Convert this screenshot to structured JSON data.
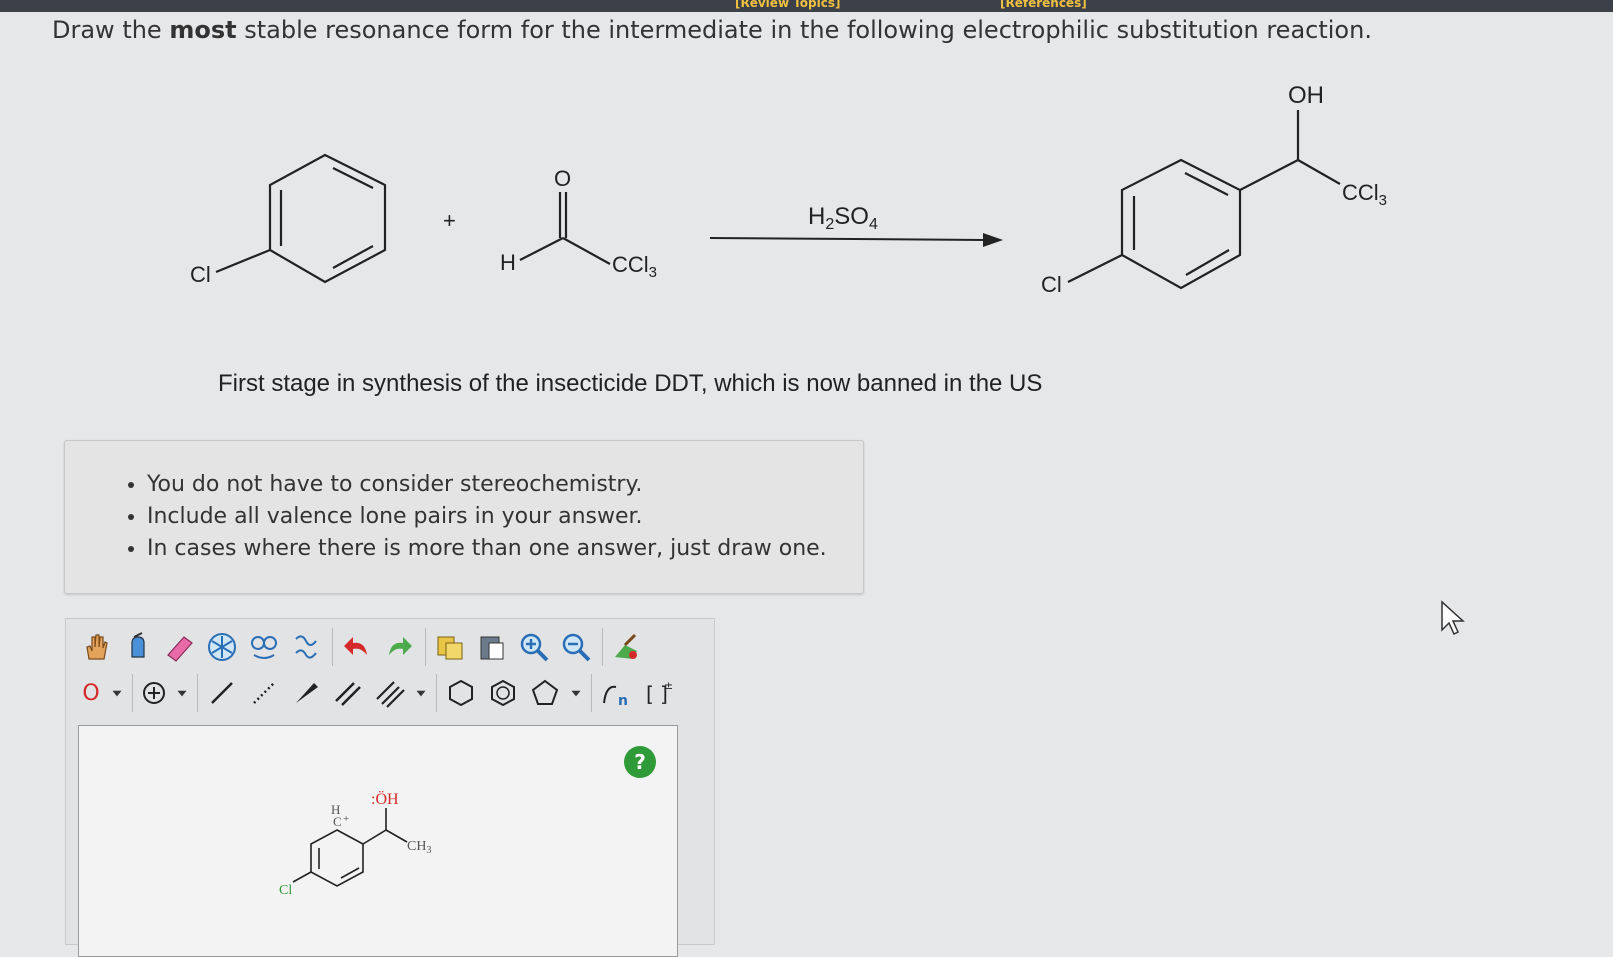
{
  "header": {
    "link_left": "[Review Topics]",
    "link_right": "[References]"
  },
  "question": {
    "prefix": "Draw the ",
    "emphasis": "most",
    "suffix": " stable resonance form for the intermediate in the following electrophilic substitution reaction."
  },
  "reaction": {
    "plus": "+",
    "reagent": "H2SO4",
    "labels": {
      "cl": "Cl",
      "h": "H",
      "o": "O",
      "ccl3": "CCl3",
      "oh": "OH"
    }
  },
  "caption": "First stage in synthesis of the insecticide DDT, which is now banned in the US",
  "notes": [
    "You do not have to consider stereochemistry.",
    "Include all valence lone pairs in your answer.",
    "In cases where there is more than one answer, just draw one."
  ],
  "editor": {
    "atom_selector": "O",
    "help_label": "?",
    "drawing": {
      "h_label": "H",
      "c_label": "C",
      "charge": "+",
      "oh_label": ":ÖH",
      "ch3_label": "CH3",
      "cl_label": "Cl"
    }
  },
  "colors": {
    "accent_red": "#d42a2a",
    "help_green": "#2f9a38"
  }
}
